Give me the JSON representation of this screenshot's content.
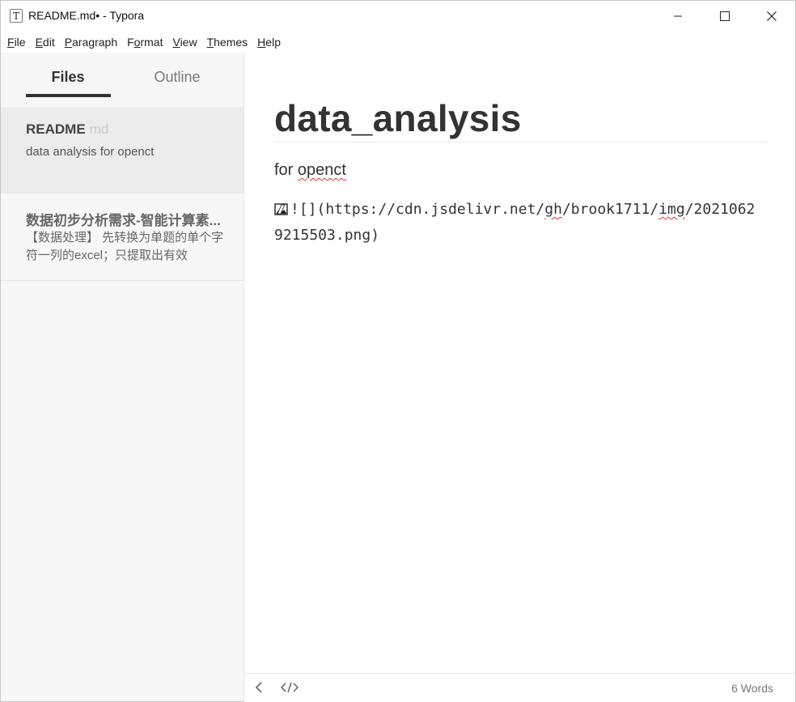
{
  "window": {
    "title": "README.md• - Typora",
    "app_icon_letter": "T"
  },
  "menu": [
    {
      "underline": "F",
      "rest": "ile"
    },
    {
      "underline": "E",
      "rest": "dit"
    },
    {
      "underline": "P",
      "rest": "aragraph"
    },
    {
      "underline": "",
      "rest": "F",
      "underline_after": "o",
      "rest_after": "rmat"
    },
    {
      "underline": "V",
      "rest": "iew"
    },
    {
      "underline": "T",
      "rest": "hemes"
    },
    {
      "underline": "H",
      "rest": "elp"
    }
  ],
  "sidebar": {
    "tabs": {
      "files": "Files",
      "outline": "Outline"
    },
    "files": [
      {
        "name": "README",
        "ext": "md",
        "desc": "data analysis for openct"
      },
      {
        "name": "数据初步分析需求-智能计算素...",
        "desc": "【数据处理】 先转换为单题的单个字符一列的excel；只提取出有效"
      }
    ]
  },
  "editor": {
    "heading": "data_analysis",
    "paragraph": {
      "before": "for ",
      "misspelled": "openct"
    },
    "code_line_1": {
      "prefix": "![](https://cdn.jsdelivr.net/",
      "w1": "gh",
      "mid": "/brook1711/",
      "w2": "img",
      "suffix": "/2021062"
    },
    "code_line_2": "9215503.png)"
  },
  "statusbar": {
    "word_count": "6 Words"
  }
}
